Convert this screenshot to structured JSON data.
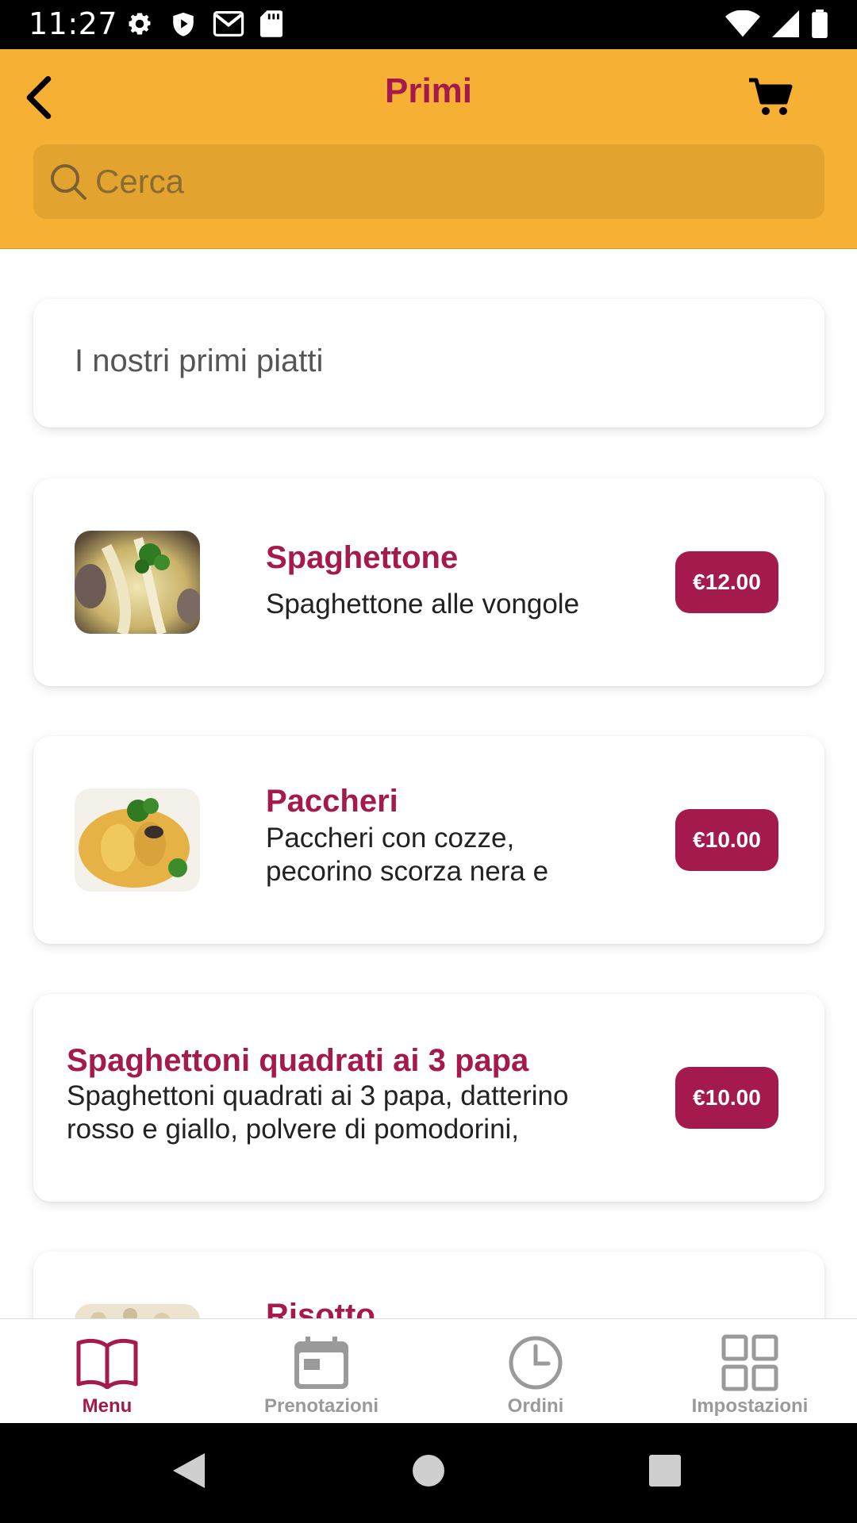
{
  "status_bar": {
    "time": "11:27"
  },
  "header": {
    "title": "Primi"
  },
  "search": {
    "placeholder": "Cerca"
  },
  "intro": {
    "text": "I nostri primi piatti"
  },
  "items": [
    {
      "title": "Spaghettone",
      "description": "Spaghettone alle vongole",
      "price": "€12.00",
      "has_image": true
    },
    {
      "title": "Paccheri",
      "description": "Paccheri con cozze, pecorino scorza nera e basilico",
      "price": "€10.00",
      "has_image": true
    },
    {
      "title": "Spaghettoni quadrati ai 3 papa",
      "description": "Spaghettoni quadrati ai 3 papa, datterino rosso e giallo, polvere di pomodorini, crumble e basilico",
      "price": "€10.00",
      "has_image": false
    },
    {
      "title": "Risotto",
      "description": "",
      "price": "",
      "has_image": true
    }
  ],
  "bottom_nav": {
    "menu": "Menu",
    "prenotazioni": "Prenotazioni",
    "ordini": "Ordini",
    "impostazioni": "Impostazioni"
  },
  "colors": {
    "accent": "#a51a4d",
    "header_bg": "#f6b034",
    "search_bg": "#e3a42f"
  }
}
